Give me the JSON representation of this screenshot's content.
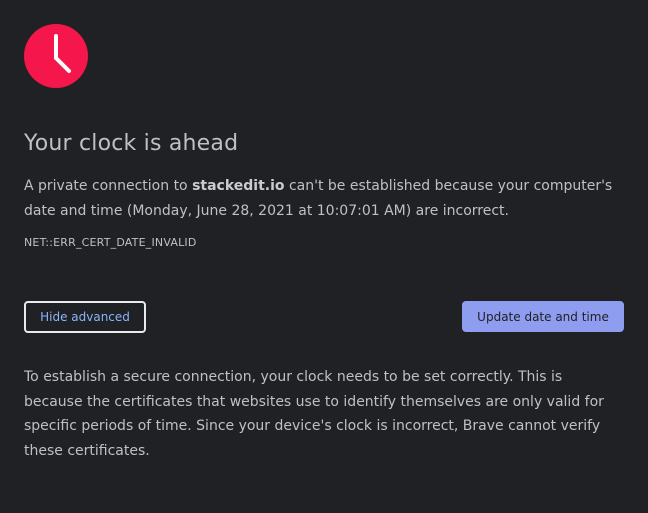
{
  "icon": {
    "name": "clock-icon",
    "color": "#f5164b"
  },
  "heading": {
    "title": "Your clock is ahead"
  },
  "message": {
    "prefix": "A private connection to ",
    "host": "stackedit.io",
    "suffix": " can't be established because your computer's date and time (Monday, June 28, 2021 at 10:07:01 AM) are incorrect."
  },
  "error_code": "NET::ERR_CERT_DATE_INVALID",
  "buttons": {
    "hide_advanced": "Hide advanced",
    "update_date_time": "Update date and time"
  },
  "details": "To establish a secure connection, your clock needs to be set correctly. This is because the certificates that websites use to identify themselves are only valid for specific periods of time. Since your device's clock is incorrect, Brave cannot verify these certificates.",
  "colors": {
    "background": "#202124",
    "text": "#bdc1c6",
    "primary_button": "#8f9df0",
    "link": "#8ab4f8"
  }
}
